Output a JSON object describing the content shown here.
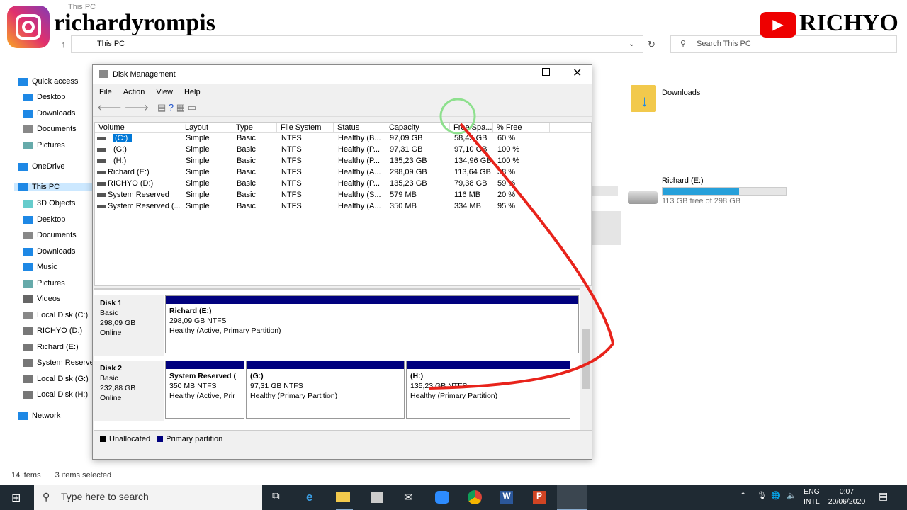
{
  "watermarks": {
    "instagram": "richardyrompis",
    "youtube": "RICHYO"
  },
  "explorer": {
    "title": "This PC",
    "address": "This PC",
    "search_placeholder": "Search This PC",
    "nav": [
      {
        "label": "Quick access",
        "icon": "star-icon"
      },
      {
        "label": "Desktop",
        "icon": "desktop-icon"
      },
      {
        "label": "Downloads",
        "icon": "download-icon"
      },
      {
        "label": "Documents",
        "icon": "document-icon"
      },
      {
        "label": "Pictures",
        "icon": "picture-icon"
      },
      {
        "label": "OneDrive",
        "icon": "cloud-icon"
      },
      {
        "label": "This PC",
        "icon": "computer-icon"
      },
      {
        "label": "3D Objects",
        "icon": "cube-icon"
      },
      {
        "label": "Desktop",
        "icon": "desktop-icon"
      },
      {
        "label": "Documents",
        "icon": "document-icon"
      },
      {
        "label": "Downloads",
        "icon": "download-icon"
      },
      {
        "label": "Music",
        "icon": "music-icon"
      },
      {
        "label": "Pictures",
        "icon": "picture-icon"
      },
      {
        "label": "Videos",
        "icon": "video-icon"
      },
      {
        "label": "Local Disk (C:)",
        "icon": "drive-icon"
      },
      {
        "label": "RICHYO (D:)",
        "icon": "drive-icon"
      },
      {
        "label": "Richard (E:)",
        "icon": "drive-icon"
      },
      {
        "label": "System Reserve",
        "icon": "drive-icon"
      },
      {
        "label": "Local Disk (G:)",
        "icon": "drive-icon"
      },
      {
        "label": "Local Disk (H:)",
        "icon": "drive-icon"
      },
      {
        "label": "Network",
        "icon": "network-icon"
      }
    ],
    "downloads_folder": "Downloads",
    "drive_e": {
      "label": "Richard (E:)",
      "free_text": "113 GB free of 298 GB",
      "used_fraction": 0.62
    },
    "status_items": "14 items",
    "status_selected": "3 items selected"
  },
  "disk_management": {
    "title": "Disk Management",
    "menu": [
      "File",
      "Action",
      "View",
      "Help"
    ],
    "columns": [
      "Volume",
      "Layout",
      "Type",
      "File System",
      "Status",
      "Capacity",
      "Free Spa...",
      "% Free"
    ],
    "rows": [
      [
        "(C:)",
        "Simple",
        "Basic",
        "NTFS",
        "Healthy (B...",
        "97,09 GB",
        "58,45 GB",
        "60 %"
      ],
      [
        "(G:)",
        "Simple",
        "Basic",
        "NTFS",
        "Healthy (P...",
        "97,31 GB",
        "97,10 GB",
        "100 %"
      ],
      [
        "(H:)",
        "Simple",
        "Basic",
        "NTFS",
        "Healthy (P...",
        "135,23 GB",
        "134,96 GB",
        "100 %"
      ],
      [
        "Richard (E:)",
        "Simple",
        "Basic",
        "NTFS",
        "Healthy (A...",
        "298,09 GB",
        "113,64 GB",
        "38 %"
      ],
      [
        "RICHYO (D:)",
        "Simple",
        "Basic",
        "NTFS",
        "Healthy (P...",
        "135,23 GB",
        "79,38 GB",
        "59 %"
      ],
      [
        "System Reserved",
        "Simple",
        "Basic",
        "NTFS",
        "Healthy (S...",
        "579 MB",
        "116 MB",
        "20 %"
      ],
      [
        "System Reserved (...",
        "Simple",
        "Basic",
        "NTFS",
        "Healthy (A...",
        "350 MB",
        "334 MB",
        "95 %"
      ]
    ],
    "disks": [
      {
        "name": "Disk 1",
        "type": "Basic",
        "size": "298,09 GB",
        "state": "Online",
        "partitions": [
          {
            "name": "Richard  (E:)",
            "size": "298,09 GB NTFS",
            "status": "Healthy (Active, Primary Partition)"
          }
        ]
      },
      {
        "name": "Disk 2",
        "type": "Basic",
        "size": "232,88 GB",
        "state": "Online",
        "partitions": [
          {
            "name": "System Reserved  (",
            "size": "350 MB NTFS",
            "status": "Healthy (Active, Prir"
          },
          {
            "name": "(G:)",
            "size": "97,31 GB NTFS",
            "status": "Healthy (Primary Partition)"
          },
          {
            "name": "(H:)",
            "size": "135,23 GB NTFS",
            "status": "Healthy (Primary Partition)"
          }
        ]
      }
    ],
    "legend": [
      {
        "label": "Unallocated",
        "color": "#000000"
      },
      {
        "label": "Primary partition",
        "color": "#00007e"
      }
    ]
  },
  "taskbar": {
    "search_placeholder": "Type here to search",
    "lang1": "ENG",
    "lang2": "INTL",
    "time": "0:07",
    "date": "20/06/2020"
  }
}
